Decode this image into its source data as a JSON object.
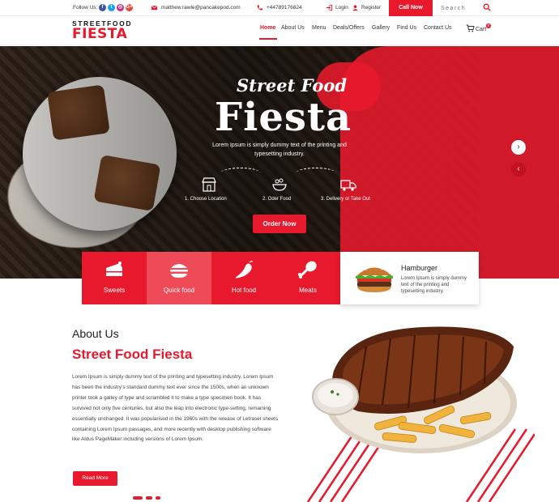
{
  "topbar": {
    "follow_label": "Follow Us:",
    "social": {
      "facebook": "f",
      "twitter": "t",
      "instagram": "◎",
      "googleplus": "G+"
    },
    "email": "matthew.rawle@pancakepod.com",
    "phone": "+44789176824",
    "login": "Login",
    "register": "Register",
    "call_now": "Call Now",
    "search_placeholder": "Search"
  },
  "header": {
    "logo_top": "STREETFOOD",
    "logo_main": "FIESTA",
    "nav": [
      "Home",
      "About Us",
      "Menu",
      "Deals/Offers",
      "Gallery",
      "Find Us",
      "Contact Us"
    ],
    "cart_label": "Cart",
    "cart_count": "0"
  },
  "hero": {
    "script": "Street Food",
    "title": "Fiesta",
    "subtitle": "Lorem Ipsum is simply dummy text of the printing and typesetting industry.",
    "steps": [
      "1. Choose Location",
      "2. Oder Food",
      "3. Delivery or Take Out"
    ],
    "order_button": "Order Now",
    "next_arrow": "›",
    "prev_arrow": "‹"
  },
  "categories": {
    "items": [
      "Sweets",
      "Quick food",
      "Hot food",
      "Meats"
    ],
    "active_index": 1,
    "preview": {
      "title": "Hamburger",
      "description": "Lorem Ipsum is simply dummy text of the printing and typesetting industry."
    }
  },
  "about": {
    "heading": "About Us",
    "title": "Street Food Fiesta",
    "body": "Lorem Ipsum is simply dummy text of the printing and typesetting industry. Lorem Ipsum has been the industry's standard dummy text ever since the 1500s, when an unknown printer took a galley of type and scrambled it to make a type specimen book. It has survived not only five centuries, but also the leap into electronic type-setting, remaining essentially unchanged. It was popularised in the 1960s with the release of Letraset sheets containing Lorem Ipsum passages, and more recently with desktop publishing software like Aldus PageMaker including versions of Lorem Ipsum.",
    "read_more": "Read More"
  },
  "colors": {
    "accent": "#e8192c",
    "dark": "#222222"
  }
}
